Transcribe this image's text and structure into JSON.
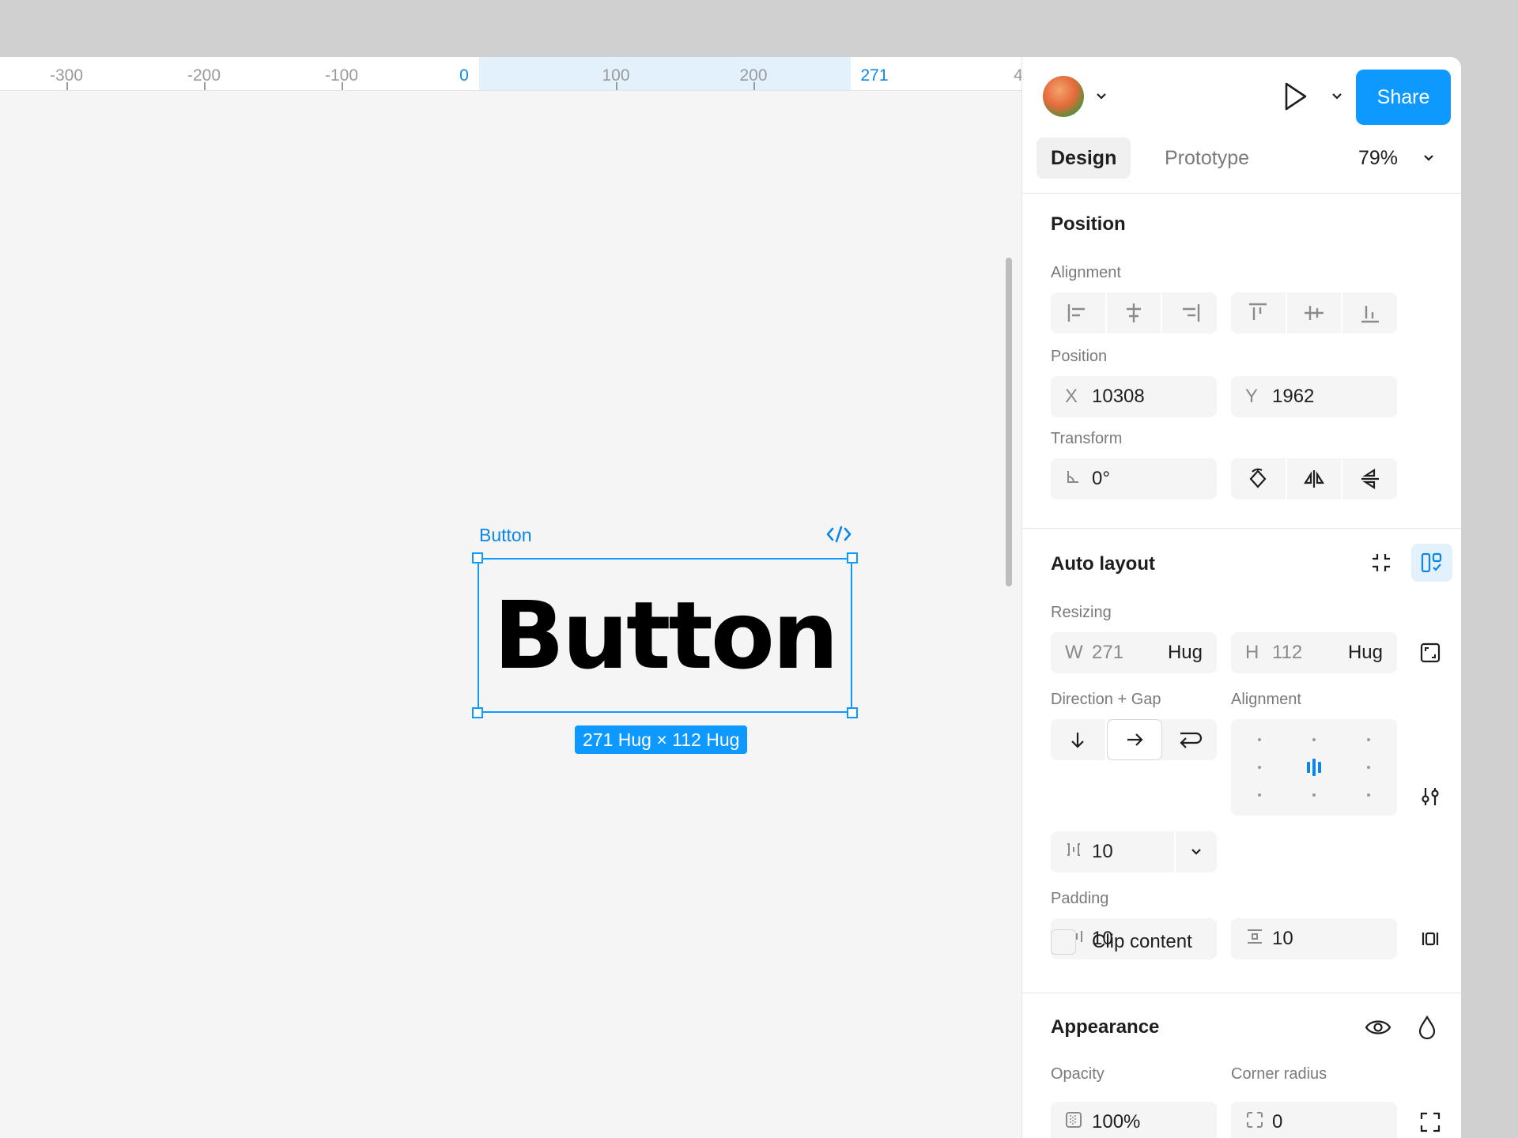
{
  "ruler": {
    "ticks": [
      "-300",
      "-200",
      "-100",
      "0",
      "100",
      "200",
      "271",
      "4"
    ]
  },
  "canvas": {
    "frame_label": "Button",
    "frame_text": "Button",
    "dimension_badge": "271 Hug × 112 Hug"
  },
  "header": {
    "share_label": "Share"
  },
  "tabs": {
    "design": "Design",
    "prototype": "Prototype",
    "zoom": "79%"
  },
  "position_section": {
    "title": "Position",
    "alignment_label": "Alignment",
    "position_label": "Position",
    "x_prefix": "X",
    "x_value": "10308",
    "y_prefix": "Y",
    "y_value": "1962",
    "transform_label": "Transform",
    "rotation_value": "0°"
  },
  "auto_layout": {
    "title": "Auto layout",
    "resizing_label": "Resizing",
    "w_prefix": "W",
    "w_value": "271",
    "w_mode": "Hug",
    "h_prefix": "H",
    "h_value": "112",
    "h_mode": "Hug",
    "direction_label": "Direction + Gap",
    "alignment_label": "Alignment",
    "gap_value": "10",
    "padding_label": "Padding",
    "padding_h": "10",
    "padding_v": "10",
    "clip_label": "Clip content"
  },
  "appearance": {
    "title": "Appearance",
    "opacity_label": "Opacity",
    "opacity_value": "100%",
    "radius_label": "Corner radius",
    "radius_value": "0"
  },
  "colors": {
    "accent": "#0d99ff",
    "ruler_accent": "#0d86e8"
  }
}
